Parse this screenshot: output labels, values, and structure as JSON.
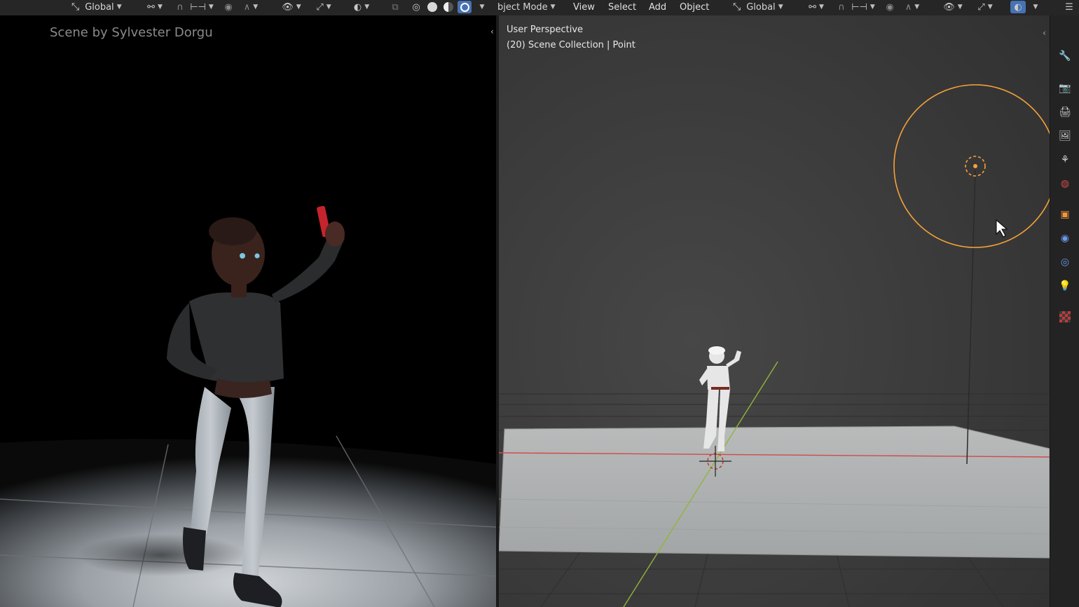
{
  "left_header": {
    "transform_orientation": "Global"
  },
  "right_header": {
    "mode": "bject Mode",
    "menus": [
      "View",
      "Select",
      "Add",
      "Object"
    ],
    "transform_orientation": "Global"
  },
  "left_viewport": {
    "credit": "Scene by Sylvester Dorgu"
  },
  "right_viewport": {
    "perspective": "User Perspective",
    "collection": "(20) Scene Collection | Point"
  },
  "colors": {
    "accent": "#4772b3",
    "light_selection": "#f5a13a",
    "axis_x": "#d04a4a",
    "axis_y": "#8fb53a",
    "topbar": "#262626"
  },
  "icons": {
    "properties_tabs": [
      "tool-icon",
      "render-icon",
      "output-icon",
      "view-layer-icon",
      "scene-icon",
      "world-icon",
      "object-icon",
      "modifier-icon",
      "physics-icon",
      "light-data-icon",
      "texture-icon"
    ]
  }
}
